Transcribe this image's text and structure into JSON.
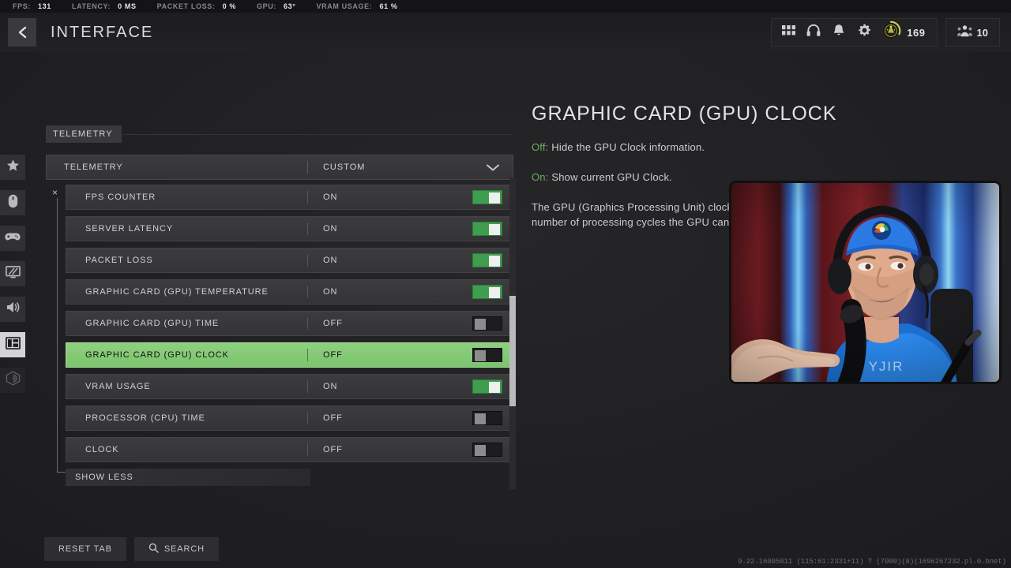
{
  "telemetry_bar": [
    {
      "label": "FPS:",
      "value": "131"
    },
    {
      "label": "LATENCY:",
      "value": "0 MS"
    },
    {
      "label": "PACKET LOSS:",
      "value": "0 %"
    },
    {
      "label": "GPU:",
      "value": "63°"
    },
    {
      "label": "VRAM USAGE:",
      "value": "61 %"
    }
  ],
  "header": {
    "title": "INTERFACE",
    "back_icon": "chevron-left-icon",
    "icons": [
      "apps-grid-icon",
      "headset-icon",
      "bell-icon",
      "gear-icon"
    ],
    "rank_count": "169",
    "party_count": "10"
  },
  "rail": [
    {
      "icon": "star-icon",
      "name": "favorites",
      "active": false
    },
    {
      "icon": "mouse-icon",
      "name": "mouse-keyboard",
      "active": false
    },
    {
      "icon": "gamepad-icon",
      "name": "controller",
      "active": false
    },
    {
      "icon": "monitor-icon",
      "name": "graphics",
      "active": false
    },
    {
      "icon": "speaker-icon",
      "name": "audio",
      "active": false
    },
    {
      "icon": "interface-layout-icon",
      "name": "interface",
      "active": true
    },
    {
      "icon": "radar-icon",
      "name": "account",
      "active": false
    }
  ],
  "settings": {
    "tab_label": "TELEMETRY",
    "dropdown": {
      "label": "TELEMETRY",
      "value": "CUSTOM",
      "chevron": "chevron-down-icon"
    },
    "close_marker": "×",
    "rows": [
      {
        "label": "FPS COUNTER",
        "value": "ON",
        "on": true,
        "selected": false
      },
      {
        "label": "SERVER LATENCY",
        "value": "ON",
        "on": true,
        "selected": false
      },
      {
        "label": "PACKET LOSS",
        "value": "ON",
        "on": true,
        "selected": false
      },
      {
        "label": "GRAPHIC CARD (GPU) TEMPERATURE",
        "value": "ON",
        "on": true,
        "selected": false
      },
      {
        "label": "GRAPHIC CARD (GPU) TIME",
        "value": "OFF",
        "on": false,
        "selected": false
      },
      {
        "label": "GRAPHIC CARD (GPU) CLOCK",
        "value": "OFF",
        "on": false,
        "selected": true
      },
      {
        "label": "VRAM USAGE",
        "value": "ON",
        "on": true,
        "selected": false
      },
      {
        "label": "PROCESSOR (CPU) TIME",
        "value": "OFF",
        "on": false,
        "selected": false
      },
      {
        "label": "CLOCK",
        "value": "OFF",
        "on": false,
        "selected": false
      }
    ],
    "show_less_label": "SHOW LESS"
  },
  "bottom_buttons": [
    {
      "label": "RESET TAB",
      "icon": null
    },
    {
      "label": "SEARCH",
      "icon": "search-icon"
    }
  ],
  "description": {
    "title": "GRAPHIC CARD (GPU) CLOCK",
    "off_key": "Off:",
    "off_text": " Hide the GPU Clock information.",
    "on_key": "On:",
    "on_text": " Show current GPU Clock.",
    "body": "The GPU (Graphics Processing Unit) clock is measured in MHz and represents the number of processing cycles the GPU can execute in 1 second."
  },
  "build_string": "9.22.16005011 (115:61:2331+11) T (7000)(8)(1696267232.pl.0.bnet)",
  "colors": {
    "accent_green": "#7cc46d",
    "toggle_on": "#3f9e4d",
    "background": "#222224",
    "panel": "#343436",
    "text": "#cfd0d1",
    "key_green": "#69b05f"
  }
}
